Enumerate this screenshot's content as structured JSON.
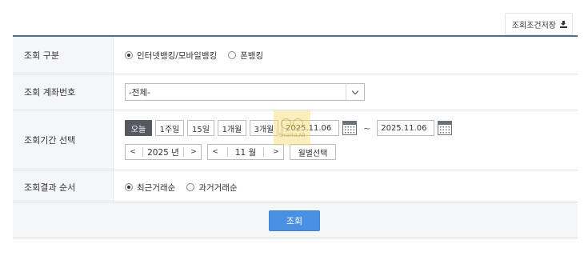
{
  "header": {
    "save_conditions_label": "조회조건저장"
  },
  "form": {
    "inquiry_type": {
      "label": "조회 구분",
      "options": [
        {
          "label": "인터넷뱅킹/모바일뱅킹",
          "selected": true
        },
        {
          "label": "폰뱅킹",
          "selected": false
        }
      ]
    },
    "account": {
      "label": "조회 계좌번호",
      "selected_value": "-전체-"
    },
    "period": {
      "label": "조회기간 선택",
      "quick_buttons": [
        {
          "label": "오늘",
          "active": true
        },
        {
          "label": "1주일",
          "active": false
        },
        {
          "label": "15일",
          "active": false
        },
        {
          "label": "1개월",
          "active": false
        },
        {
          "label": "3개월",
          "active": false
        }
      ],
      "start_date": "2025.11.06",
      "separator": "~",
      "end_date": "2025.11.06",
      "year_value": "2025 년",
      "month_value": "11 월",
      "prev_arrow": "<",
      "next_arrow": ">",
      "month_select_label": "월별선택"
    },
    "result_order": {
      "label": "조회결과 순서",
      "options": [
        {
          "label": "최근거래순",
          "selected": true
        },
        {
          "label": "과거거래순",
          "selected": false
        }
      ]
    }
  },
  "actions": {
    "search_label": "조회"
  },
  "watermark": {
    "text": "SmartsLAB"
  },
  "colors": {
    "header_border": "#4c6f92",
    "active_button": "#555a60",
    "search_button": "#4a90e2"
  }
}
